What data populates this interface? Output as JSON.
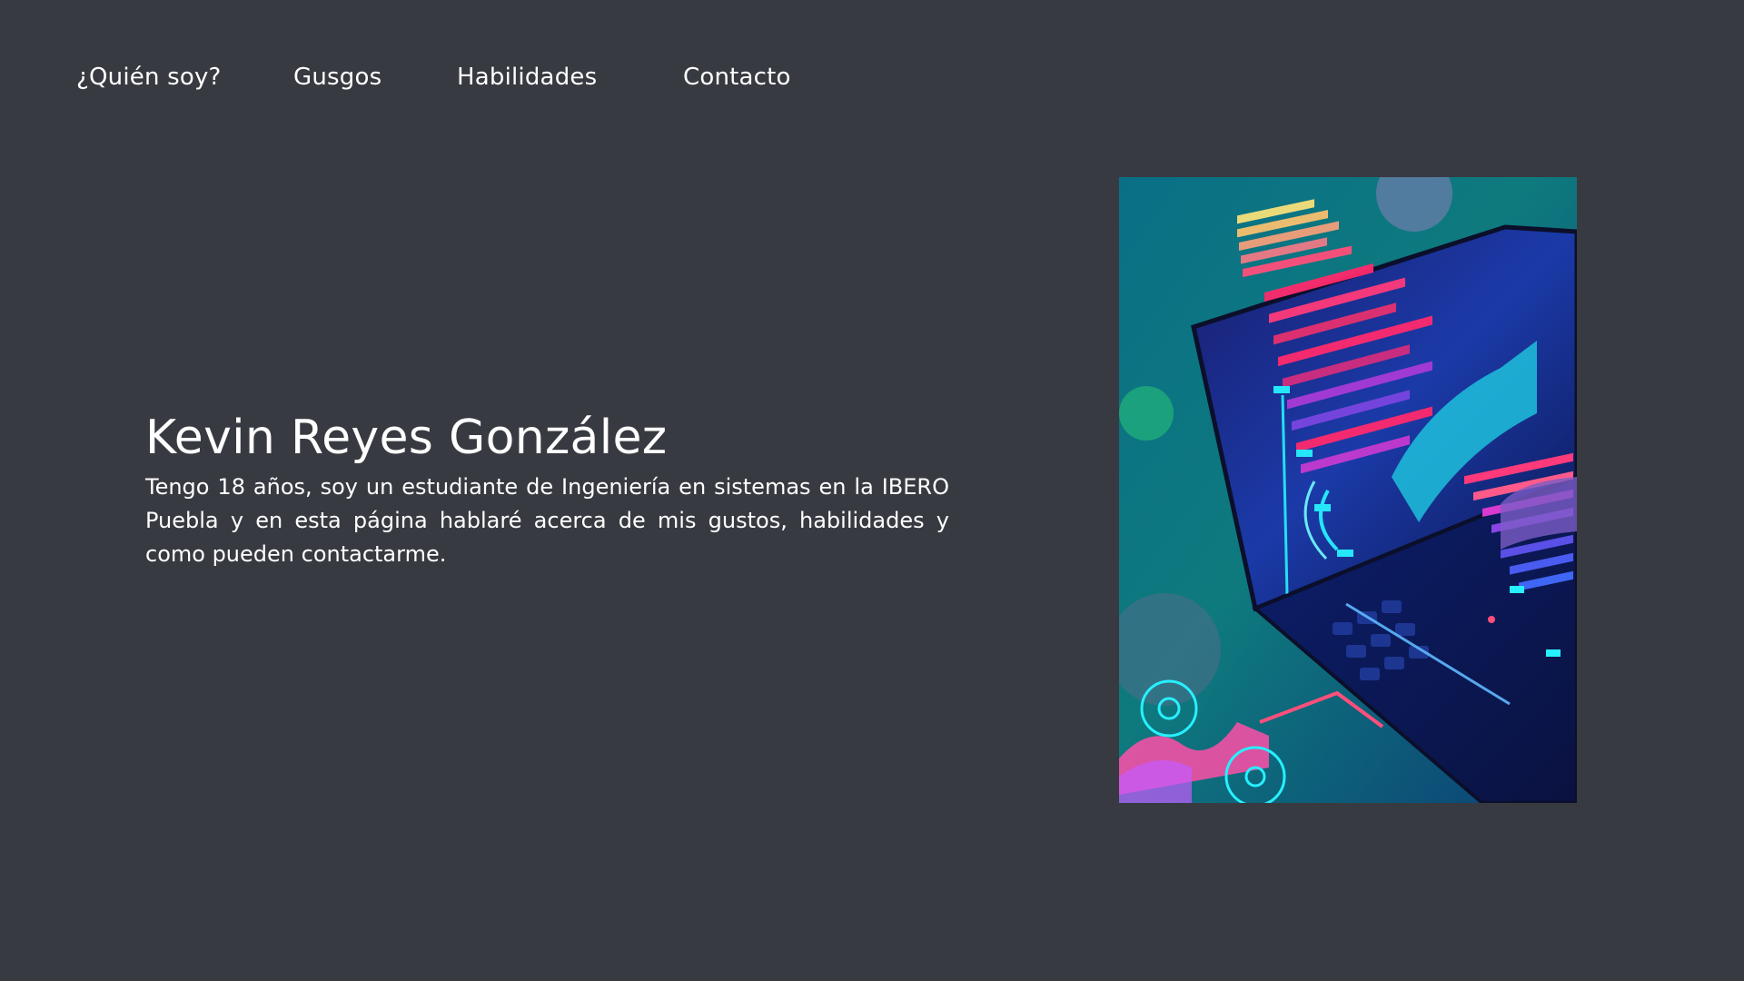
{
  "nav": {
    "items": [
      {
        "label": "¿Quién soy?"
      },
      {
        "label": "Gusgos"
      },
      {
        "label": "Habilidades"
      },
      {
        "label": "Contacto"
      }
    ]
  },
  "hero": {
    "name": "Kevin Reyes González",
    "description": "Tengo 18 años, soy un estudiante de Ingeniería en sistemas en la IBERO Puebla y en esta página hablaré acerca de mis gustos, habilidades y como pueden contactarme."
  },
  "colors": {
    "background": "#383a42",
    "text": "#ffffff",
    "art_teal": "#0f7c86",
    "art_navy": "#0d1a4d",
    "art_pink": "#ff2a6d",
    "art_cyan": "#27f0ff"
  },
  "illustration": {
    "icon": "laptop-data-illustration"
  }
}
